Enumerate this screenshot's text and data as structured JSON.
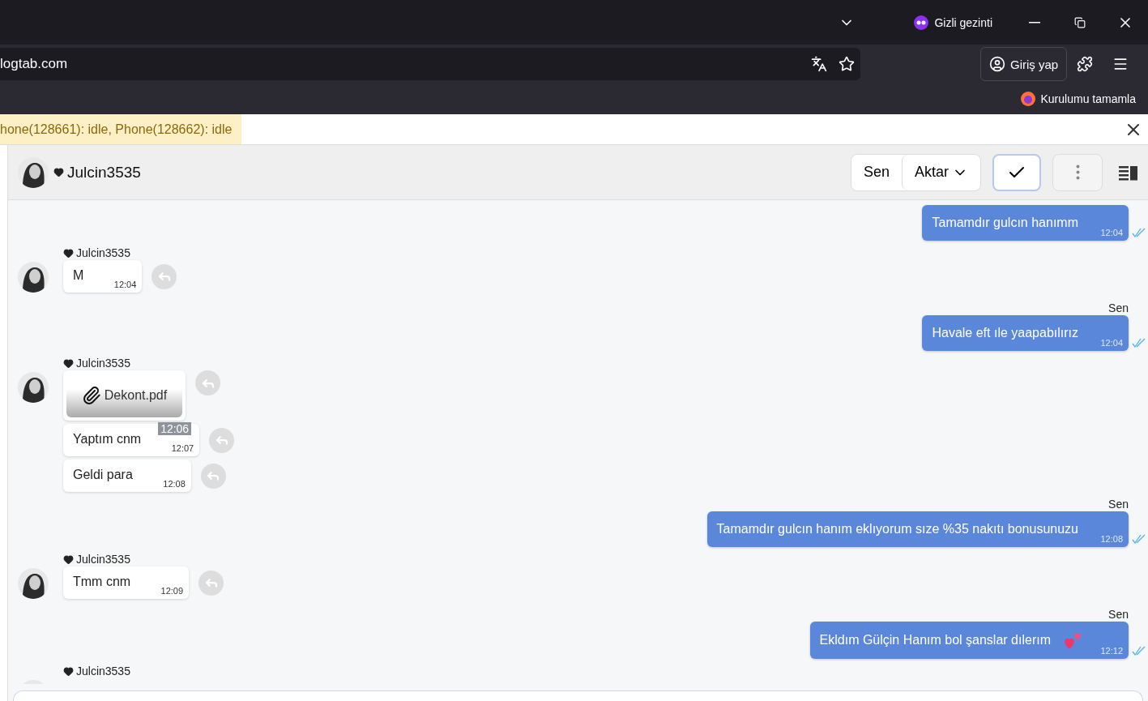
{
  "browser": {
    "mode_label": "Gizli gezinti",
    "url": "logtab.com",
    "signin": "Giriş yap",
    "bookmark": "Kurulumu tamamla"
  },
  "notice": {
    "text": "hone(128661): idle, Phone(128662): idle"
  },
  "chat_header": {
    "name": "Julcin3535",
    "sender_options": [
      {
        "label": "Sen",
        "selected": false
      },
      {
        "label": "Aktar",
        "selected": false
      }
    ]
  },
  "messages": [
    {
      "kind": "outgoing",
      "items": [
        {
          "text": "Tamamdır gulcın hanımm",
          "time": "12:04",
          "emoji": false
        }
      ]
    },
    {
      "kind": "incoming",
      "author": "Julcin3535",
      "items": [
        {
          "kind": "text",
          "text": "M",
          "time": "12:04"
        }
      ]
    },
    {
      "kind": "outgoing",
      "author": "Sen",
      "items": [
        {
          "text": "Havale eft ıle yaapabılırız",
          "time": "12:04",
          "emoji": false
        }
      ]
    },
    {
      "kind": "incoming",
      "author": "Julcin3535",
      "items": [
        {
          "kind": "file",
          "text": "Dekont.pdf"
        },
        {
          "kind": "text",
          "text": "Yaptım cnm",
          "time": "12:07",
          "overlay_time": "12:06"
        },
        {
          "kind": "text",
          "text": "Geldi para",
          "time": "12:08"
        }
      ]
    },
    {
      "kind": "outgoing",
      "author": "Sen",
      "items": [
        {
          "text": "Tamamdır gulcın hanım eklıyorum sıze %35 nakıtı bonusunuzu",
          "time": "12:08",
          "emoji": false
        }
      ]
    },
    {
      "kind": "incoming",
      "author": "Julcin3535",
      "items": [
        {
          "kind": "text",
          "text": "Tmm cnm",
          "time": "12:09"
        }
      ]
    },
    {
      "kind": "outgoing",
      "author": "Sen",
      "items": [
        {
          "text": "Ekldım Gülçin Hanım bol şanslar dılerım",
          "time": "12:12",
          "emoji": true
        }
      ]
    },
    {
      "kind": "incoming",
      "author": "Julcin3535"
    }
  ]
}
